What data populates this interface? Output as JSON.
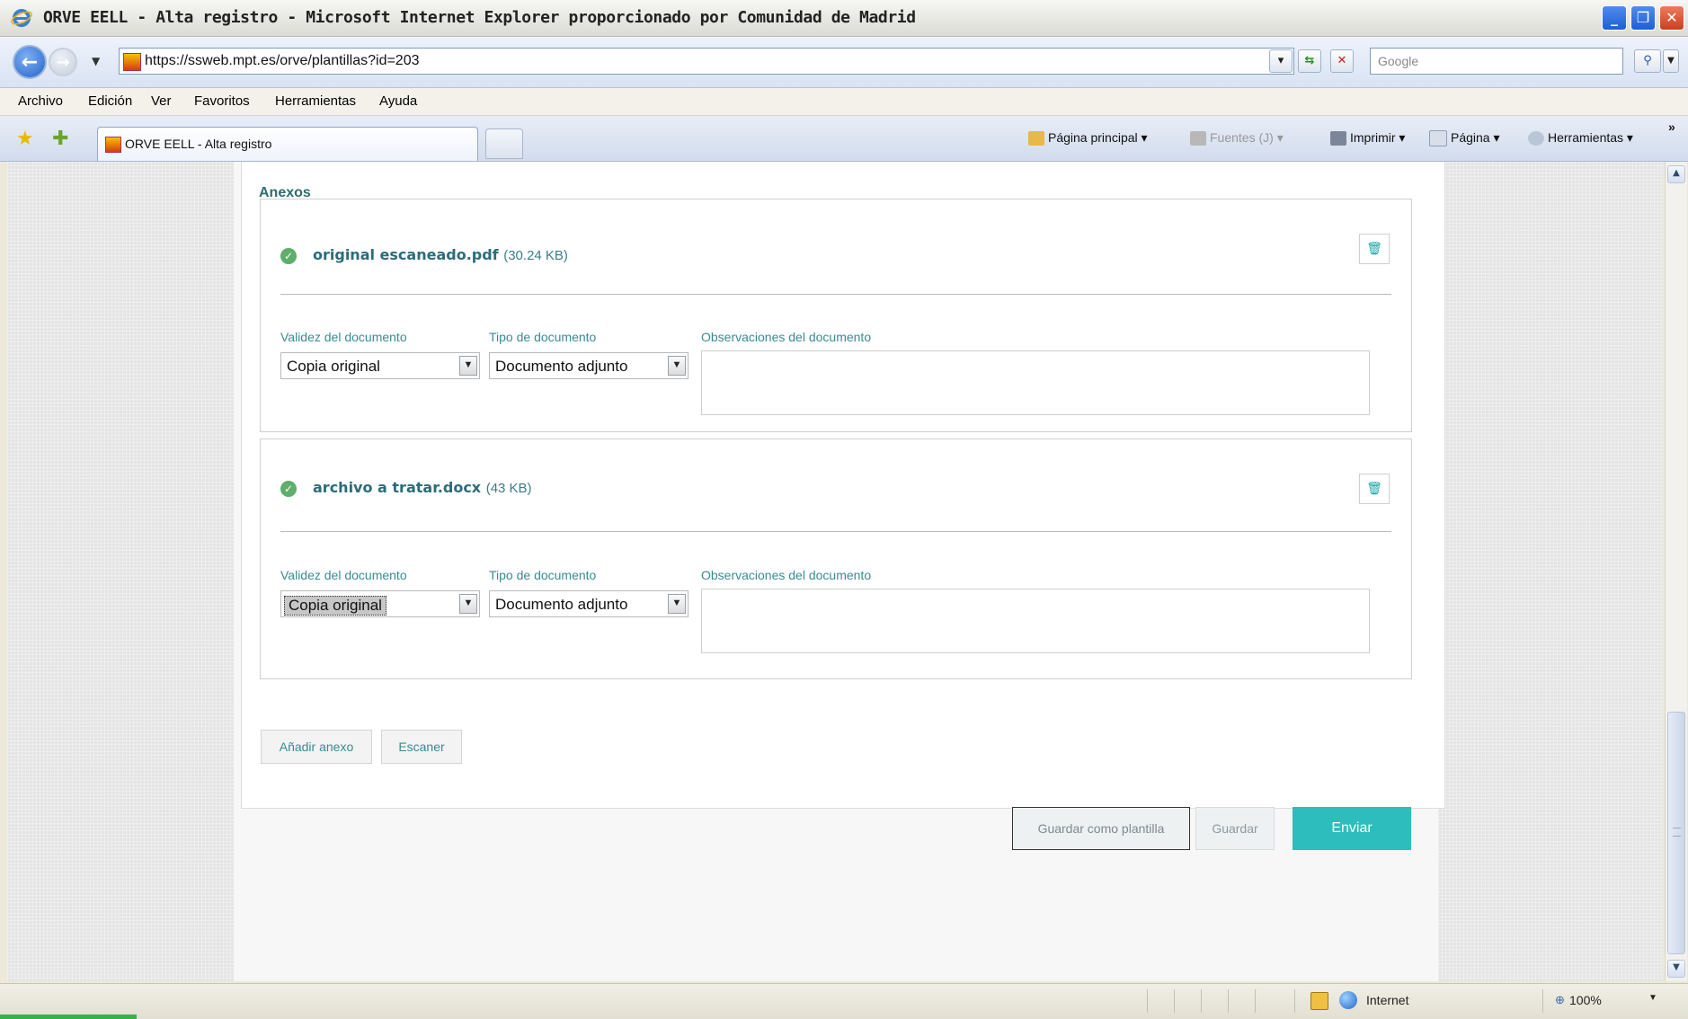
{
  "window": {
    "title": "ORVE EELL - Alta registro - Microsoft Internet Explorer proporcionado por Comunidad de Madrid",
    "minimize": "_",
    "maximize": "❐",
    "close": "✕"
  },
  "address_bar": {
    "url": "https://ssweb.mpt.es/orve/plantillas?id=203",
    "search_placeholder": "Google"
  },
  "menu": [
    "Archivo",
    "Edición",
    "Ver",
    "Favoritos",
    "Herramientas",
    "Ayuda"
  ],
  "tabs": {
    "active_label": "ORVE EELL - Alta registro"
  },
  "command_bar": {
    "home": "Página principal",
    "feeds": "Fuentes (J)",
    "print": "Imprimir",
    "page": "Página",
    "tools": "Herramientas",
    "more": "»"
  },
  "content": {
    "section_title": "Anexos",
    "annexes": [
      {
        "file_name": "original escaneado.pdf",
        "file_size": "(30.24 KB)",
        "validity_label": "Validez del documento",
        "validity_value": "Copia original",
        "type_label": "Tipo de documento",
        "type_value": "Documento adjunto",
        "observations_label": "Observaciones del documento"
      },
      {
        "file_name": "archivo a tratar.docx",
        "file_size": "(43 KB)",
        "validity_label": "Validez del documento",
        "validity_value": "Copia original",
        "type_label": "Tipo de documento",
        "type_value": "Documento adjunto",
        "observations_label": "Observaciones del documento"
      }
    ],
    "add_annex_button": "Añadir anexo",
    "scan_button": "Escaner",
    "save_template_button": "Guardar como plantilla",
    "save_button": "Guardar",
    "send_button": "Enviar"
  },
  "status_bar": {
    "zone": "Internet",
    "zoom": "100%"
  },
  "colors": {
    "accent": "#2dbdbd",
    "link_text": "#2a6d78",
    "success": "#5fae6b"
  }
}
